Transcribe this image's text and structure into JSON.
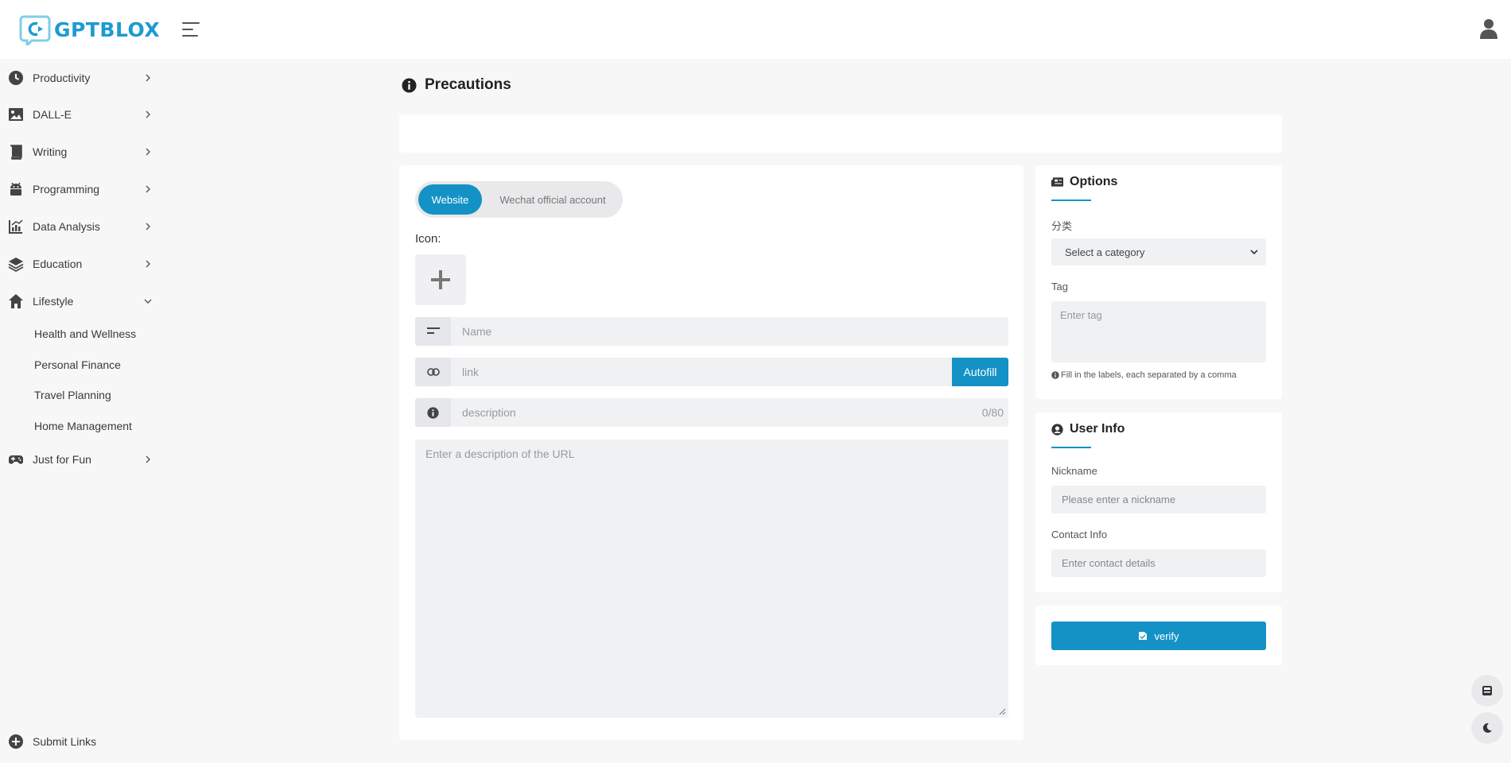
{
  "brand": {
    "name": "GPTBLOX",
    "accent": "#1492c6",
    "logo_color": "#1d9bd1"
  },
  "header": {
    "menu_icon": "hamburger-icon",
    "user_icon": "user-icon"
  },
  "sidebar": {
    "items": [
      {
        "label": "Productivity",
        "icon": "clock-icon"
      },
      {
        "label": "DALL-E",
        "icon": "image-icon"
      },
      {
        "label": "Writing",
        "icon": "book-icon"
      },
      {
        "label": "Programming",
        "icon": "android-icon"
      },
      {
        "label": "Data Analysis",
        "icon": "chart-icon"
      },
      {
        "label": "Education",
        "icon": "layers-icon"
      },
      {
        "label": "Lifestyle",
        "icon": "home-icon",
        "expanded": true
      },
      {
        "label": "Just for Fun",
        "icon": "gamepad-icon"
      }
    ],
    "lifestyle_sub": [
      "Health and Wellness",
      "Personal Finance",
      "Travel Planning",
      "Home Management"
    ],
    "submit_links": "Submit Links"
  },
  "main": {
    "precautions_title": "Precautions",
    "toggle": {
      "active": "Website",
      "other": "Wechat official account"
    },
    "icon_label": "Icon:",
    "name_placeholder": "Name",
    "link_placeholder": "link",
    "autofill_label": "Autofill",
    "description_placeholder": "description",
    "description_counter": "0/80",
    "url_desc_placeholder": "Enter a description of the URL"
  },
  "options": {
    "title": "Options",
    "category_label": "分类",
    "category_value": "Select a category",
    "tag_label": "Tag",
    "tag_placeholder": "Enter tag",
    "tag_hint": "Fill in the labels, each separated by a comma"
  },
  "user_info": {
    "title": "User Info",
    "nickname_label": "Nickname",
    "nickname_placeholder": "Please enter a nickname",
    "contact_label": "Contact Info",
    "contact_placeholder": "Enter contact details"
  },
  "verify_label": "verify"
}
